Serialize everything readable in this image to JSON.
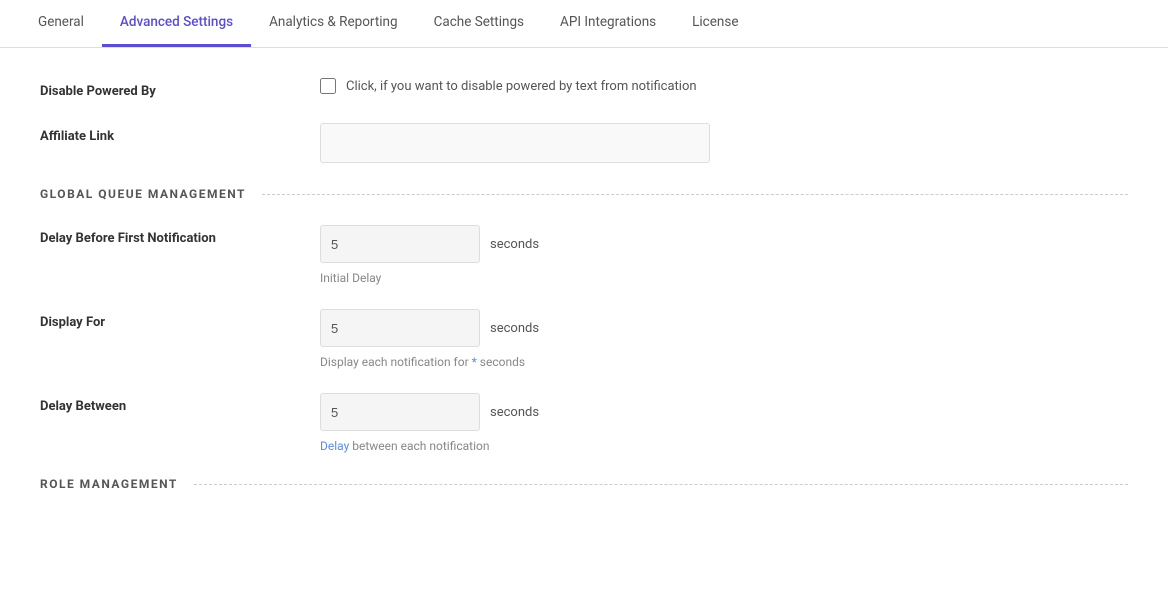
{
  "tabs": [
    {
      "id": "general",
      "label": "General",
      "active": false
    },
    {
      "id": "advanced-settings",
      "label": "Advanced Settings",
      "active": true
    },
    {
      "id": "analytics-reporting",
      "label": "Analytics & Reporting",
      "active": false
    },
    {
      "id": "cache-settings",
      "label": "Cache Settings",
      "active": false
    },
    {
      "id": "api-integrations",
      "label": "API Integrations",
      "active": false
    },
    {
      "id": "license",
      "label": "License",
      "active": false
    }
  ],
  "sections": {
    "powered_by": {
      "label": "Disable Powered By",
      "checkbox_text": "Click, if you want to disable powered by text from notification"
    },
    "affiliate_link": {
      "label": "Affiliate Link",
      "placeholder": ""
    },
    "global_queue": {
      "title": "GLOBAL QUEUE MANAGEMENT"
    },
    "delay_before_first": {
      "label": "Delay Before First Notification",
      "value": "5",
      "unit": "seconds",
      "help_text": "Initial Delay",
      "help_highlight": ""
    },
    "display_for": {
      "label": "Display For",
      "value": "5",
      "unit": "seconds",
      "help_prefix": "Display each notification for ",
      "help_highlight": "*",
      "help_suffix": " seconds"
    },
    "delay_between": {
      "label": "Delay Between",
      "value": "5",
      "unit": "seconds",
      "help_prefix": "Delay",
      "help_middle": " between each notification",
      "help_highlight": ""
    },
    "role_management": {
      "title": "ROLE MANAGEMENT"
    }
  }
}
